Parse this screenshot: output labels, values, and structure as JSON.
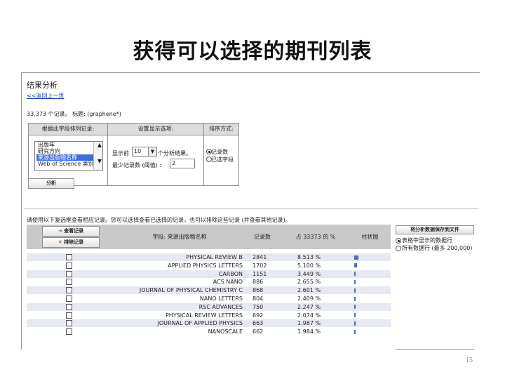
{
  "slide": {
    "title": "获得可以选择的期刊列表",
    "page_number": "15"
  },
  "header": {
    "title": "结果分析",
    "back_link": "<<返回上一页",
    "summary": "33,373 个记录。 标题: (graphene*)"
  },
  "options": {
    "col1_header": "根据此字段排列记录:",
    "col2_header": "设置显示选项:",
    "col3_header": "排序方式:",
    "fields": [
      {
        "label": "出版年",
        "selected": false
      },
      {
        "label": "研究方向",
        "selected": false
      },
      {
        "label": "来源出版物名称",
        "selected": true
      },
      {
        "label": "Web of Science 类别",
        "selected": false
      }
    ],
    "show_prefix": "显示前",
    "show_value": "10",
    "show_suffix": "个分析结果。",
    "min_label": "最少记录数 (阈值) :",
    "min_value": "2",
    "sort_options": [
      {
        "label": "记录数",
        "checked": true
      },
      {
        "label": "已选字段",
        "checked": false
      }
    ],
    "analyze_button": "分析"
  },
  "hint": "请使用以下复选框查看相应记录。您可以选择查看已选择的记录，也可以排除这些记录 (并查看其他记录)。",
  "table": {
    "view_button": "查看记录",
    "exclude_button": "排除记录",
    "col_field": "字段: 来源出版物名称",
    "col_count": "记录数",
    "col_percent": "占 33373 的 %",
    "col_bar": "柱状图",
    "rows": [
      {
        "name": "PHYSICAL REVIEW B",
        "count": "2841",
        "percent": "8.513 %",
        "share": 8.513
      },
      {
        "name": "APPLIED PHYSICS LETTERS",
        "count": "1702",
        "percent": "5.100 %",
        "share": 5.1
      },
      {
        "name": "CARBON",
        "count": "1151",
        "percent": "3.449 %",
        "share": 3.449
      },
      {
        "name": "ACS NANO",
        "count": "886",
        "percent": "2.655 %",
        "share": 2.655
      },
      {
        "name": "JOURNAL OF PHYSICAL CHEMISTRY C",
        "count": "868",
        "percent": "2.601 %",
        "share": 2.601
      },
      {
        "name": "NANO LETTERS",
        "count": "804",
        "percent": "2.409 %",
        "share": 2.409
      },
      {
        "name": "RSC ADVANCES",
        "count": "750",
        "percent": "2.247 %",
        "share": 2.247
      },
      {
        "name": "PHYSICAL REVIEW LETTERS",
        "count": "692",
        "percent": "2.074 %",
        "share": 2.074
      },
      {
        "name": "JOURNAL OF APPLIED PHYSICS",
        "count": "663",
        "percent": "1.987 %",
        "share": 1.987
      },
      {
        "name": "NANOSCALE",
        "count": "662",
        "percent": "1.984 %",
        "share": 1.984
      }
    ]
  },
  "save": {
    "button": "将分析数据保存到文件",
    "options": [
      {
        "label": "表格中显示的数据行",
        "checked": true
      },
      {
        "label": "所有数据行 (最多 200,000)",
        "checked": false
      }
    ]
  },
  "colors": {
    "bar": "#4c6eb8",
    "link": "#1f3f9f",
    "header_gray": "#c9c9c9",
    "selection": "#3a6ed8"
  }
}
